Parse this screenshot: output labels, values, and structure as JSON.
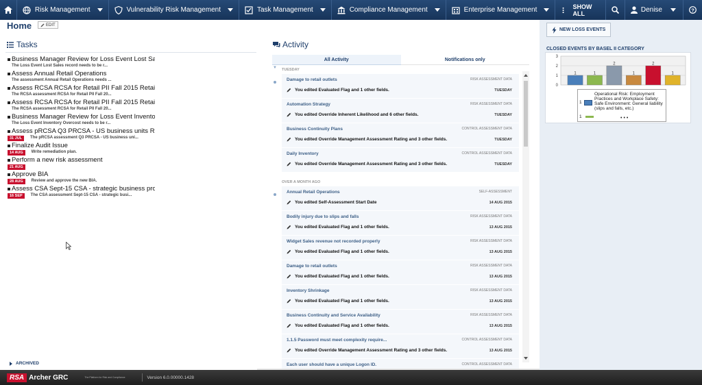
{
  "nav": {
    "items": [
      {
        "label": "Risk Management",
        "icon": "globe-icon"
      },
      {
        "label": "Vulnerability Risk Management",
        "icon": "shield-icon"
      },
      {
        "label": "Task Management",
        "icon": "checklist-icon"
      },
      {
        "label": "Compliance Management",
        "icon": "building-icon"
      },
      {
        "label": "Enterprise Management",
        "icon": "enterprise-icon"
      }
    ],
    "show_all": "SHOW ALL",
    "user": "Denise"
  },
  "home": {
    "title": "Home",
    "edit_label": "EDIT"
  },
  "tasks": {
    "heading": "Tasks",
    "items": [
      {
        "title": "Business Manager Review for Loss Event Lost Sal...",
        "sub": "The Loss Event Lost Sales record needs to be r...",
        "badge": ""
      },
      {
        "title": "Assess Annual Retail Operations",
        "sub": "The assessment Annual Retail Operations needs ...",
        "badge": ""
      },
      {
        "title": "Assess RCSA RCSA for Retail PII Fall 2015 Retai...",
        "sub": "The RCSA assessment RCSA for Retail PII Fall 20...",
        "badge": ""
      },
      {
        "title": "Assess RCSA RCSA for Retail PII Fall 2015 Retai...",
        "sub": "The RCSA assessment RCSA for Retail PII Fall 20...",
        "badge": ""
      },
      {
        "title": "Business Manager Review for Loss Event Inventor...",
        "sub": "The Loss Event Inventory Overcost needs to be r...",
        "badge": ""
      },
      {
        "title": "Assess pRCSA Q3 PRCSA - US business units Retai...",
        "sub": "The pRCSA assessment Q3 PRCSA - US business uni...",
        "badge": "31 JUL"
      },
      {
        "title": "Finalize Audit Issue",
        "sub": "Write remediation plan.",
        "badge": "14 AUG"
      },
      {
        "title": "Perform a new risk assessment",
        "sub": "",
        "badge": "21 AUG"
      },
      {
        "title": "Approve BIA",
        "sub": "Review and approve the new BIA.",
        "badge": "28 AUG"
      },
      {
        "title": "Assess CSA Sept-15 CSA - strategic business pro...",
        "sub": "The CSA assessment Sept-15 CSA - strategic busi...",
        "badge": "16 SEP"
      }
    ],
    "archived": "ARCHIVED"
  },
  "activity": {
    "heading": "Activity",
    "tab_all": "All Activity",
    "tab_notifications": "Notifications only",
    "group1": "TUESDAY",
    "group2": "OVER A MONTH AGO",
    "entries1": [
      {
        "title": "Damage to retail outlets",
        "type": "RISK ASSESSMENT DATA",
        "desc": "You edited Evaluated Flag and 1 other fields.",
        "date": "TUESDAY"
      },
      {
        "title": "Automation Strategy",
        "type": "RISK ASSESSMENT DATA",
        "desc": "You edited Override Inherent Likelihood and 6 other fields.",
        "date": "TUESDAY"
      },
      {
        "title": "Business Continuity Plans",
        "type": "CONTROL ASSESSMENT DATA",
        "desc": "You edited Override Management Assessment Rating and 3 other fields.",
        "date": "TUESDAY"
      },
      {
        "title": "Daily Inventory",
        "type": "CONTROL ASSESSMENT DATA",
        "desc": "You edited Override Management Assessment Rating and 3 other fields.",
        "date": "TUESDAY"
      }
    ],
    "entries2": [
      {
        "title": "Annual Retail Operations",
        "type": "SELF-ASSESSMENT",
        "desc": "You edited Self-Assessment Start Date",
        "date": "14 AUG 2015"
      },
      {
        "title": "Bodily injury due to slips and falls",
        "type": "RISK ASSESSMENT DATA",
        "desc": "You edited Evaluated Flag and 1 other fields.",
        "date": "13 AUG 2015"
      },
      {
        "title": "Widget Sales revenue not recorded properly",
        "type": "RISK ASSESSMENT DATA",
        "desc": "You edited Evaluated Flag and 1 other fields.",
        "date": "13 AUG 2015"
      },
      {
        "title": "Damage to retail outlets",
        "type": "RISK ASSESSMENT DATA",
        "desc": "You edited Evaluated Flag and 1 other fields.",
        "date": "13 AUG 2015"
      },
      {
        "title": "Inventory Shrinkage",
        "type": "RISK ASSESSMENT DATA",
        "desc": "You edited Evaluated Flag and 1 other fields.",
        "date": "13 AUG 2015"
      },
      {
        "title": "Business Continuity and Service Availability",
        "type": "RISK ASSESSMENT DATA",
        "desc": "You edited Evaluated Flag and 1 other fields.",
        "date": "13 AUG 2015"
      },
      {
        "title": "1.1.5 Password must meet complexity require...",
        "type": "CONTROL ASSESSMENT DATA",
        "desc": "You edited Override Management Assessment Rating and 3 other fields.",
        "date": "13 AUG 2015"
      },
      {
        "title": "Each user should have a unique Logon ID.",
        "type": "CONTROL ASSESSMENT DATA",
        "desc": "",
        "date": ""
      }
    ]
  },
  "right": {
    "new_loss_events": "NEW LOSS EVENTS",
    "chart_title": "CLOSED EVENTS BY BASEL II CATEGORY"
  },
  "chart_data": {
    "type": "bar",
    "title": "CLOSED EVENTS BY BASEL II CATEGORY",
    "categories": [
      "",
      "",
      "",
      "",
      "",
      ""
    ],
    "values": [
      1,
      1,
      2,
      1,
      2,
      1
    ],
    "colors": [
      "#4a7fba",
      "#8cb84f",
      "#8a99ab",
      "#c8893f",
      "#c8102e",
      "#e0b32a"
    ],
    "ylim": [
      0,
      3
    ],
    "yticks": [
      "0",
      "1",
      "2",
      "3"
    ],
    "grid": true,
    "legend": {
      "placement": "bottom",
      "entries": [
        {
          "count": "1",
          "label": "Operational Risk: Employment Practices and Workplace Safety: Safe Environment: General liability (slips and falls, etc.)",
          "color": "#4a7fba"
        },
        {
          "count": "1",
          "label": "",
          "color": "#8cb84f"
        }
      ]
    }
  },
  "footer": {
    "rsa": "RSA",
    "archer": "Archer GRC",
    "tagline": "The Platform for Risk and Compliance",
    "version": "Version 6.0.00000.1428"
  }
}
